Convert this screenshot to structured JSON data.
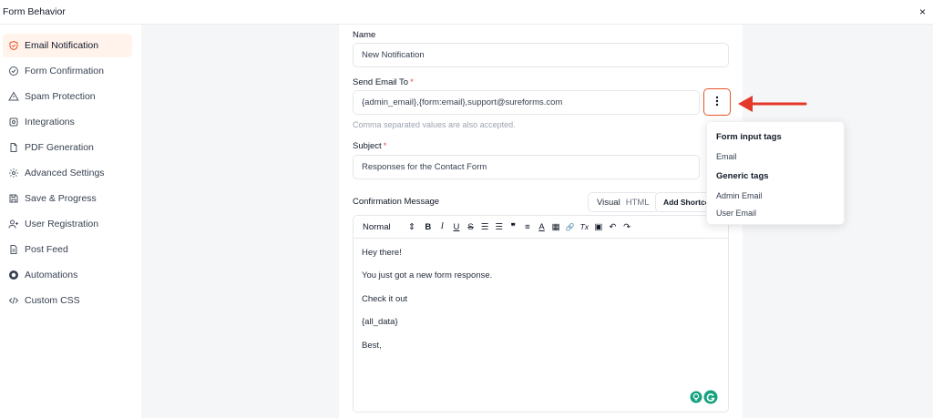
{
  "header": {
    "title": "Form Behavior",
    "close_glyph": "×"
  },
  "sidebar": {
    "items": [
      {
        "label": "Email Notification",
        "icon": "shield-check-icon",
        "active": true
      },
      {
        "label": "Form Confirmation",
        "icon": "circle-check-icon"
      },
      {
        "label": "Spam Protection",
        "icon": "warning-triangle-icon"
      },
      {
        "label": "Integrations",
        "icon": "integrations-icon"
      },
      {
        "label": "PDF Generation",
        "icon": "file-icon"
      },
      {
        "label": "Advanced Settings",
        "icon": "gear-icon"
      },
      {
        "label": "Save & Progress",
        "icon": "save-icon"
      },
      {
        "label": "User Registration",
        "icon": "user-plus-icon"
      },
      {
        "label": "Post Feed",
        "icon": "file-text-icon"
      },
      {
        "label": "Automations",
        "icon": "automation-icon"
      },
      {
        "label": "Custom CSS",
        "icon": "code-icon"
      }
    ]
  },
  "form": {
    "name_label": "Name",
    "name_value": "New Notification",
    "send_to_label": "Send Email To",
    "required_mark": "*",
    "send_to_value": "{admin_email},{form:email},support@sureforms.com",
    "send_to_help": "Comma separated values are also accepted.",
    "subject_label": "Subject",
    "subject_value": "Responses for the Contact Form",
    "message_label": "Confirmation Message"
  },
  "tags_dropdown": {
    "form_input_heading": "Form input tags",
    "form_input_items": [
      "Email"
    ],
    "generic_heading": "Generic tags",
    "generic_items": [
      "Admin Email",
      "User Email"
    ]
  },
  "editor": {
    "tab_visual": "Visual",
    "tab_html": "HTML",
    "add_shortcode": "Add Shortcode",
    "format_select": "Normal",
    "format_chevron": "⇕",
    "toolbar": {
      "bold": "B",
      "italic": "I",
      "underline": "U",
      "strike": "S",
      "ordered_list": "☰",
      "bullet_list": "☰",
      "quote": "❞",
      "align": "≡",
      "text_color": "A",
      "highlight": "▦",
      "link": "🔗",
      "clear_format": "Tx",
      "image": "▣",
      "undo": "↶",
      "redo": "↷"
    },
    "lines": [
      "Hey there!",
      "You just got a new form response.",
      "Check it out",
      "{all_data}",
      "Best,"
    ]
  },
  "colors": {
    "accent": "#e8542a",
    "active_bg": "#fff3ec",
    "canvas_bg": "#f5f6f8",
    "required": "#ef4444",
    "grammarly": "#15a37f",
    "arrow": "#e3382a"
  }
}
